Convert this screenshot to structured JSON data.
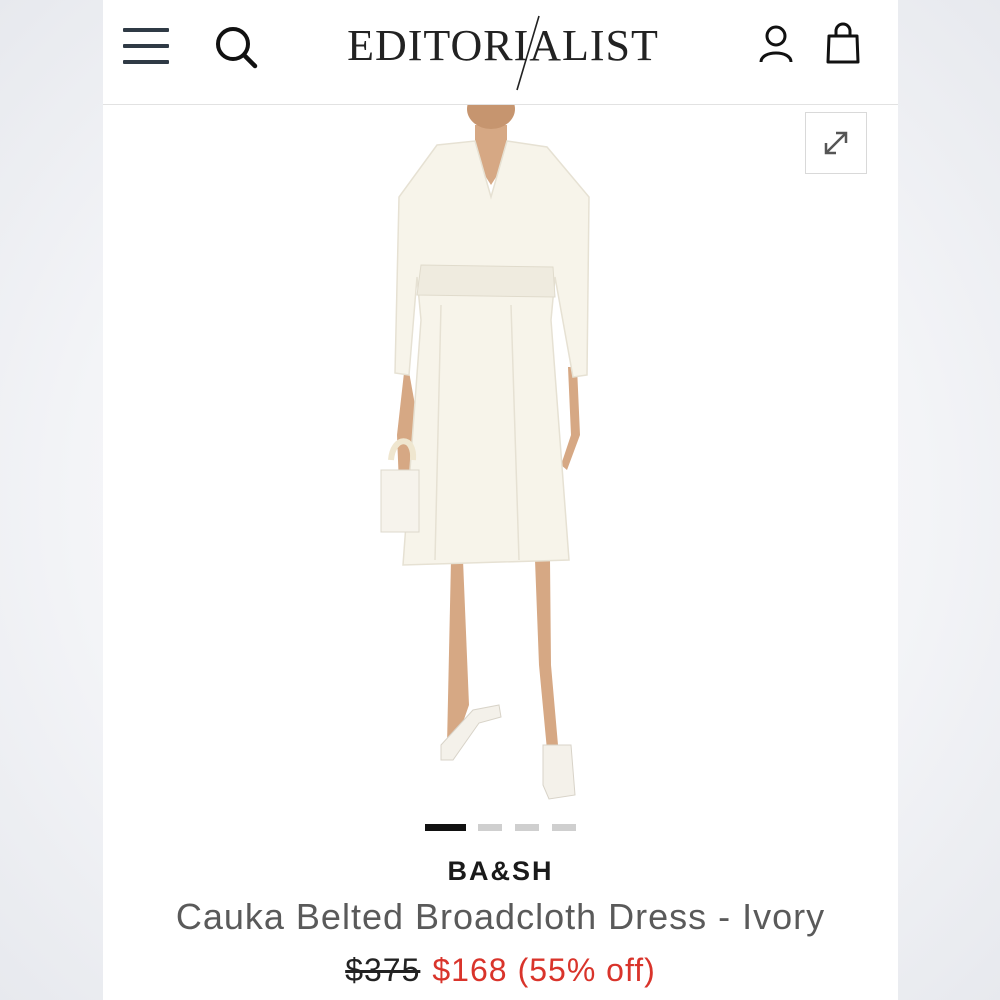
{
  "header": {
    "logo": "EDITORIALIST",
    "icons": [
      "menu-icon",
      "search-icon",
      "user-icon",
      "shopping-bag-icon"
    ]
  },
  "gallery": {
    "expand_icon": "expand-icon",
    "image_count": 4,
    "active_index": 0
  },
  "product": {
    "brand": "BA&SH",
    "title": "Cauka Belted Broadcloth Dress - Ivory",
    "price_original": "$375",
    "price_sale": "$168",
    "discount": "(55% off)"
  },
  "colors": {
    "sale": "#d9342b",
    "active_dot": "#111111",
    "inactive_dot": "#cfcfcf"
  }
}
